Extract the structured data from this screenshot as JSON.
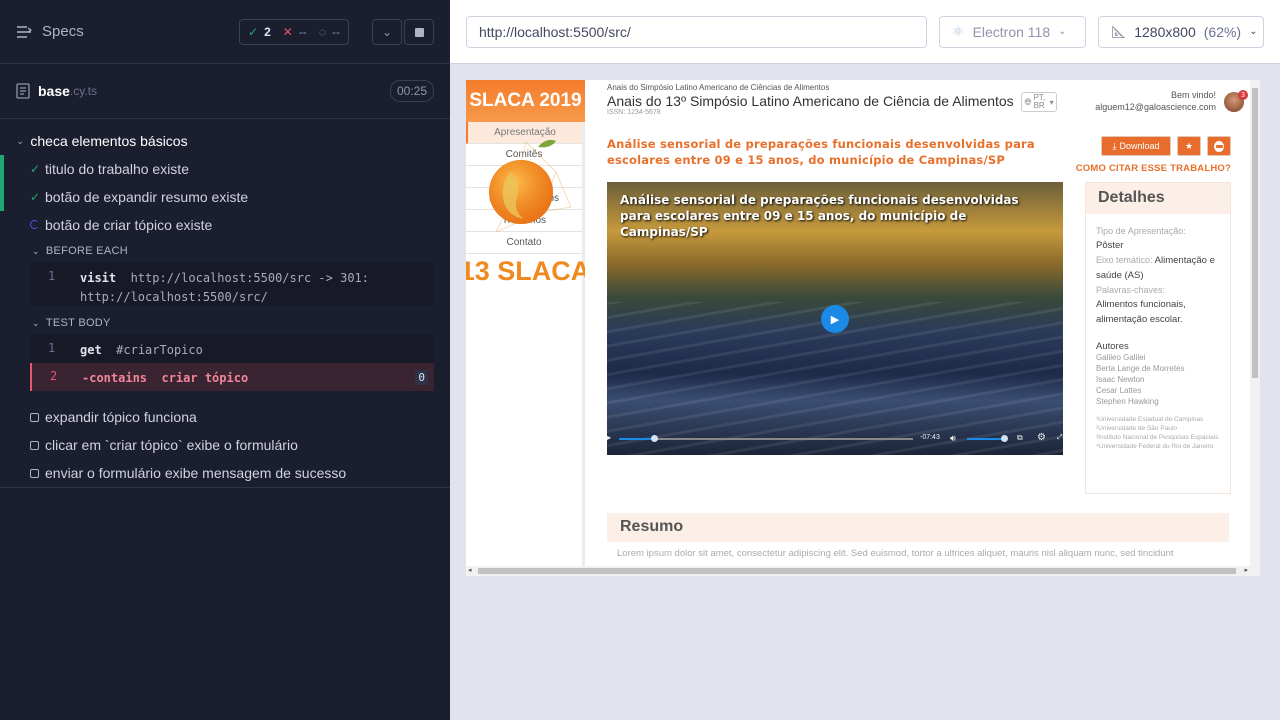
{
  "runner": {
    "specs_label": "Specs",
    "passed_count": "2",
    "failed_count": "--",
    "pending_count": "--",
    "spec_file": {
      "name": "base",
      "ext": ".cy.ts",
      "duration": "00:25"
    },
    "suite_title": "checa elementos básicos",
    "tests": [
      {
        "title": "titulo do trabalho existe",
        "state": "passed"
      },
      {
        "title": "botão de expandir resumo existe",
        "state": "passed"
      },
      {
        "title": "botão de criar tópico existe",
        "state": "running"
      }
    ],
    "before_each_label": "BEFORE EACH",
    "before_each_cmd": {
      "num": "1",
      "name": "visit",
      "arg": "http://localhost:5500/src -> 301:",
      "arg2": "http://localhost:5500/src/"
    },
    "test_body_label": "TEST BODY",
    "body_cmds": [
      {
        "num": "1",
        "name": "get",
        "arg": "#criarTopico"
      },
      {
        "num": "2",
        "name": "-contains",
        "arg": "criar tópico",
        "badge": "0"
      }
    ],
    "pending_tests": [
      "expandir tópico funciona",
      "clicar em `criar tópico` exibe o formulário",
      "enviar o formulário exibe mensagem de sucesso"
    ]
  },
  "toolbar": {
    "url": "http://localhost:5500/src/",
    "browser": "Electron 118",
    "viewport": "1280x800",
    "zoom": "(62%)"
  },
  "app": {
    "logo_text": "SLACA 2019",
    "head_small": "Anais do Simpósio Latino Americano de Ciências de Alimentos",
    "head_big": "Anais do 13º Simpósio Latino Americano de Ciência de Alimentos",
    "issn": "ISSN: 1234-5678",
    "lang": "PT, BR",
    "welcome": "Bem vindo!",
    "email": "alguem12@galoascience.com",
    "avatar_badge": "3",
    "side_logo_text": "13 SLACA",
    "nav": [
      "Apresentação",
      "Comitês",
      "Autores",
      "Eixos temáticos",
      "Trabalhos",
      "Contato"
    ],
    "paper_title": "Análise sensorial de preparações funcionais desenvolvidas para escolares entre 09 e 15 anos, do município de Campinas/SP",
    "download_label": "Download",
    "cite_label": "COMO CITAR ESSE TRABALHO?",
    "video_title": "Análise sensorial de preparações funcionais desenvolvidas para escolares entre 09 e 15 anos, do município de Campinas/SP",
    "video_time": "-07:43",
    "video_progress": 0.12,
    "details_title": "Detalhes",
    "tipo_label": "Tipo de Apresentação:",
    "tipo_value": "Pôster",
    "eixo_label": "Eixo temático:",
    "eixo_value": "Alimentação e saúde (AS)",
    "palavras_label": "Palavras-chaves:",
    "palavras_value": "Alimentos funcionais, alimentação escolar.",
    "autores_label": "Autores",
    "autores": [
      "Galileo Galilei",
      "Berta Lange de Morretes",
      "Isaac Newton",
      "Cesar Lattes",
      "Stephen Hawking"
    ],
    "afiliacoes": [
      "¹Universidade Estadual de Campinas",
      "²Universidade de São Paulo",
      "³Instituto Nacional de Pesquisas Espaciais",
      "⁴Universidade Federal do Rio de Janeiro"
    ],
    "resumo_title": "Resumo",
    "resumo_text": "Lorem ipsum dolor sit amet, consectetur adipiscing elit. Sed euismod, tortor a ultrices aliquet, mauris nisl aliquam nunc, sed tincidunt"
  },
  "colors": {
    "accent": "#f47c2c",
    "passed": "#1fa971",
    "failed": "#e45770"
  }
}
